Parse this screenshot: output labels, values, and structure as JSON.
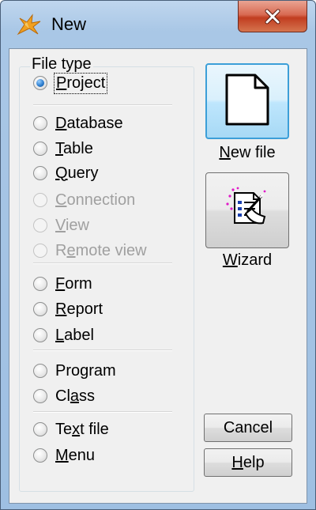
{
  "window": {
    "title": "New"
  },
  "file_type": {
    "title": "File type",
    "options": [
      {
        "pre": "",
        "key": "P",
        "post": "roject",
        "checked": true,
        "enabled": true
      },
      {
        "pre": "",
        "key": "D",
        "post": "atabase",
        "checked": false,
        "enabled": true
      },
      {
        "pre": "",
        "key": "T",
        "post": "able",
        "checked": false,
        "enabled": true
      },
      {
        "pre": "",
        "key": "Q",
        "post": "uery",
        "checked": false,
        "enabled": true
      },
      {
        "pre": "",
        "key": "C",
        "post": "onnection",
        "checked": false,
        "enabled": false
      },
      {
        "pre": "",
        "key": "V",
        "post": "iew",
        "checked": false,
        "enabled": false
      },
      {
        "pre": "R",
        "key": "e",
        "post": "mote view",
        "checked": false,
        "enabled": false
      },
      {
        "pre": "",
        "key": "F",
        "post": "orm",
        "checked": false,
        "enabled": true
      },
      {
        "pre": "",
        "key": "R",
        "post": "eport",
        "checked": false,
        "enabled": true
      },
      {
        "pre": "",
        "key": "L",
        "post": "abel",
        "checked": false,
        "enabled": true
      },
      {
        "pre": "Pro",
        "key": "g",
        "post": "ram",
        "checked": false,
        "enabled": true
      },
      {
        "pre": "Cl",
        "key": "a",
        "post": "ss",
        "checked": false,
        "enabled": true
      },
      {
        "pre": "Te",
        "key": "x",
        "post": "t file",
        "checked": false,
        "enabled": true
      },
      {
        "pre": "",
        "key": "M",
        "post": "enu",
        "checked": false,
        "enabled": true
      }
    ]
  },
  "buttons": {
    "new_file": {
      "pre": "",
      "key": "N",
      "post": "ew file"
    },
    "wizard": {
      "pre": "",
      "key": "W",
      "post": "izard"
    },
    "cancel": "Cancel",
    "help": {
      "pre": "",
      "key": "H",
      "post": "elp"
    }
  },
  "icons": {
    "app": "fox-icon",
    "close": "close-icon",
    "new_file": "blank-document-icon",
    "wizard": "wizard-wand-icon"
  },
  "colors": {
    "radio_selected": "#2f7fd0",
    "default_button_border": "#3c9fd8",
    "close_button": "#c13d20"
  }
}
